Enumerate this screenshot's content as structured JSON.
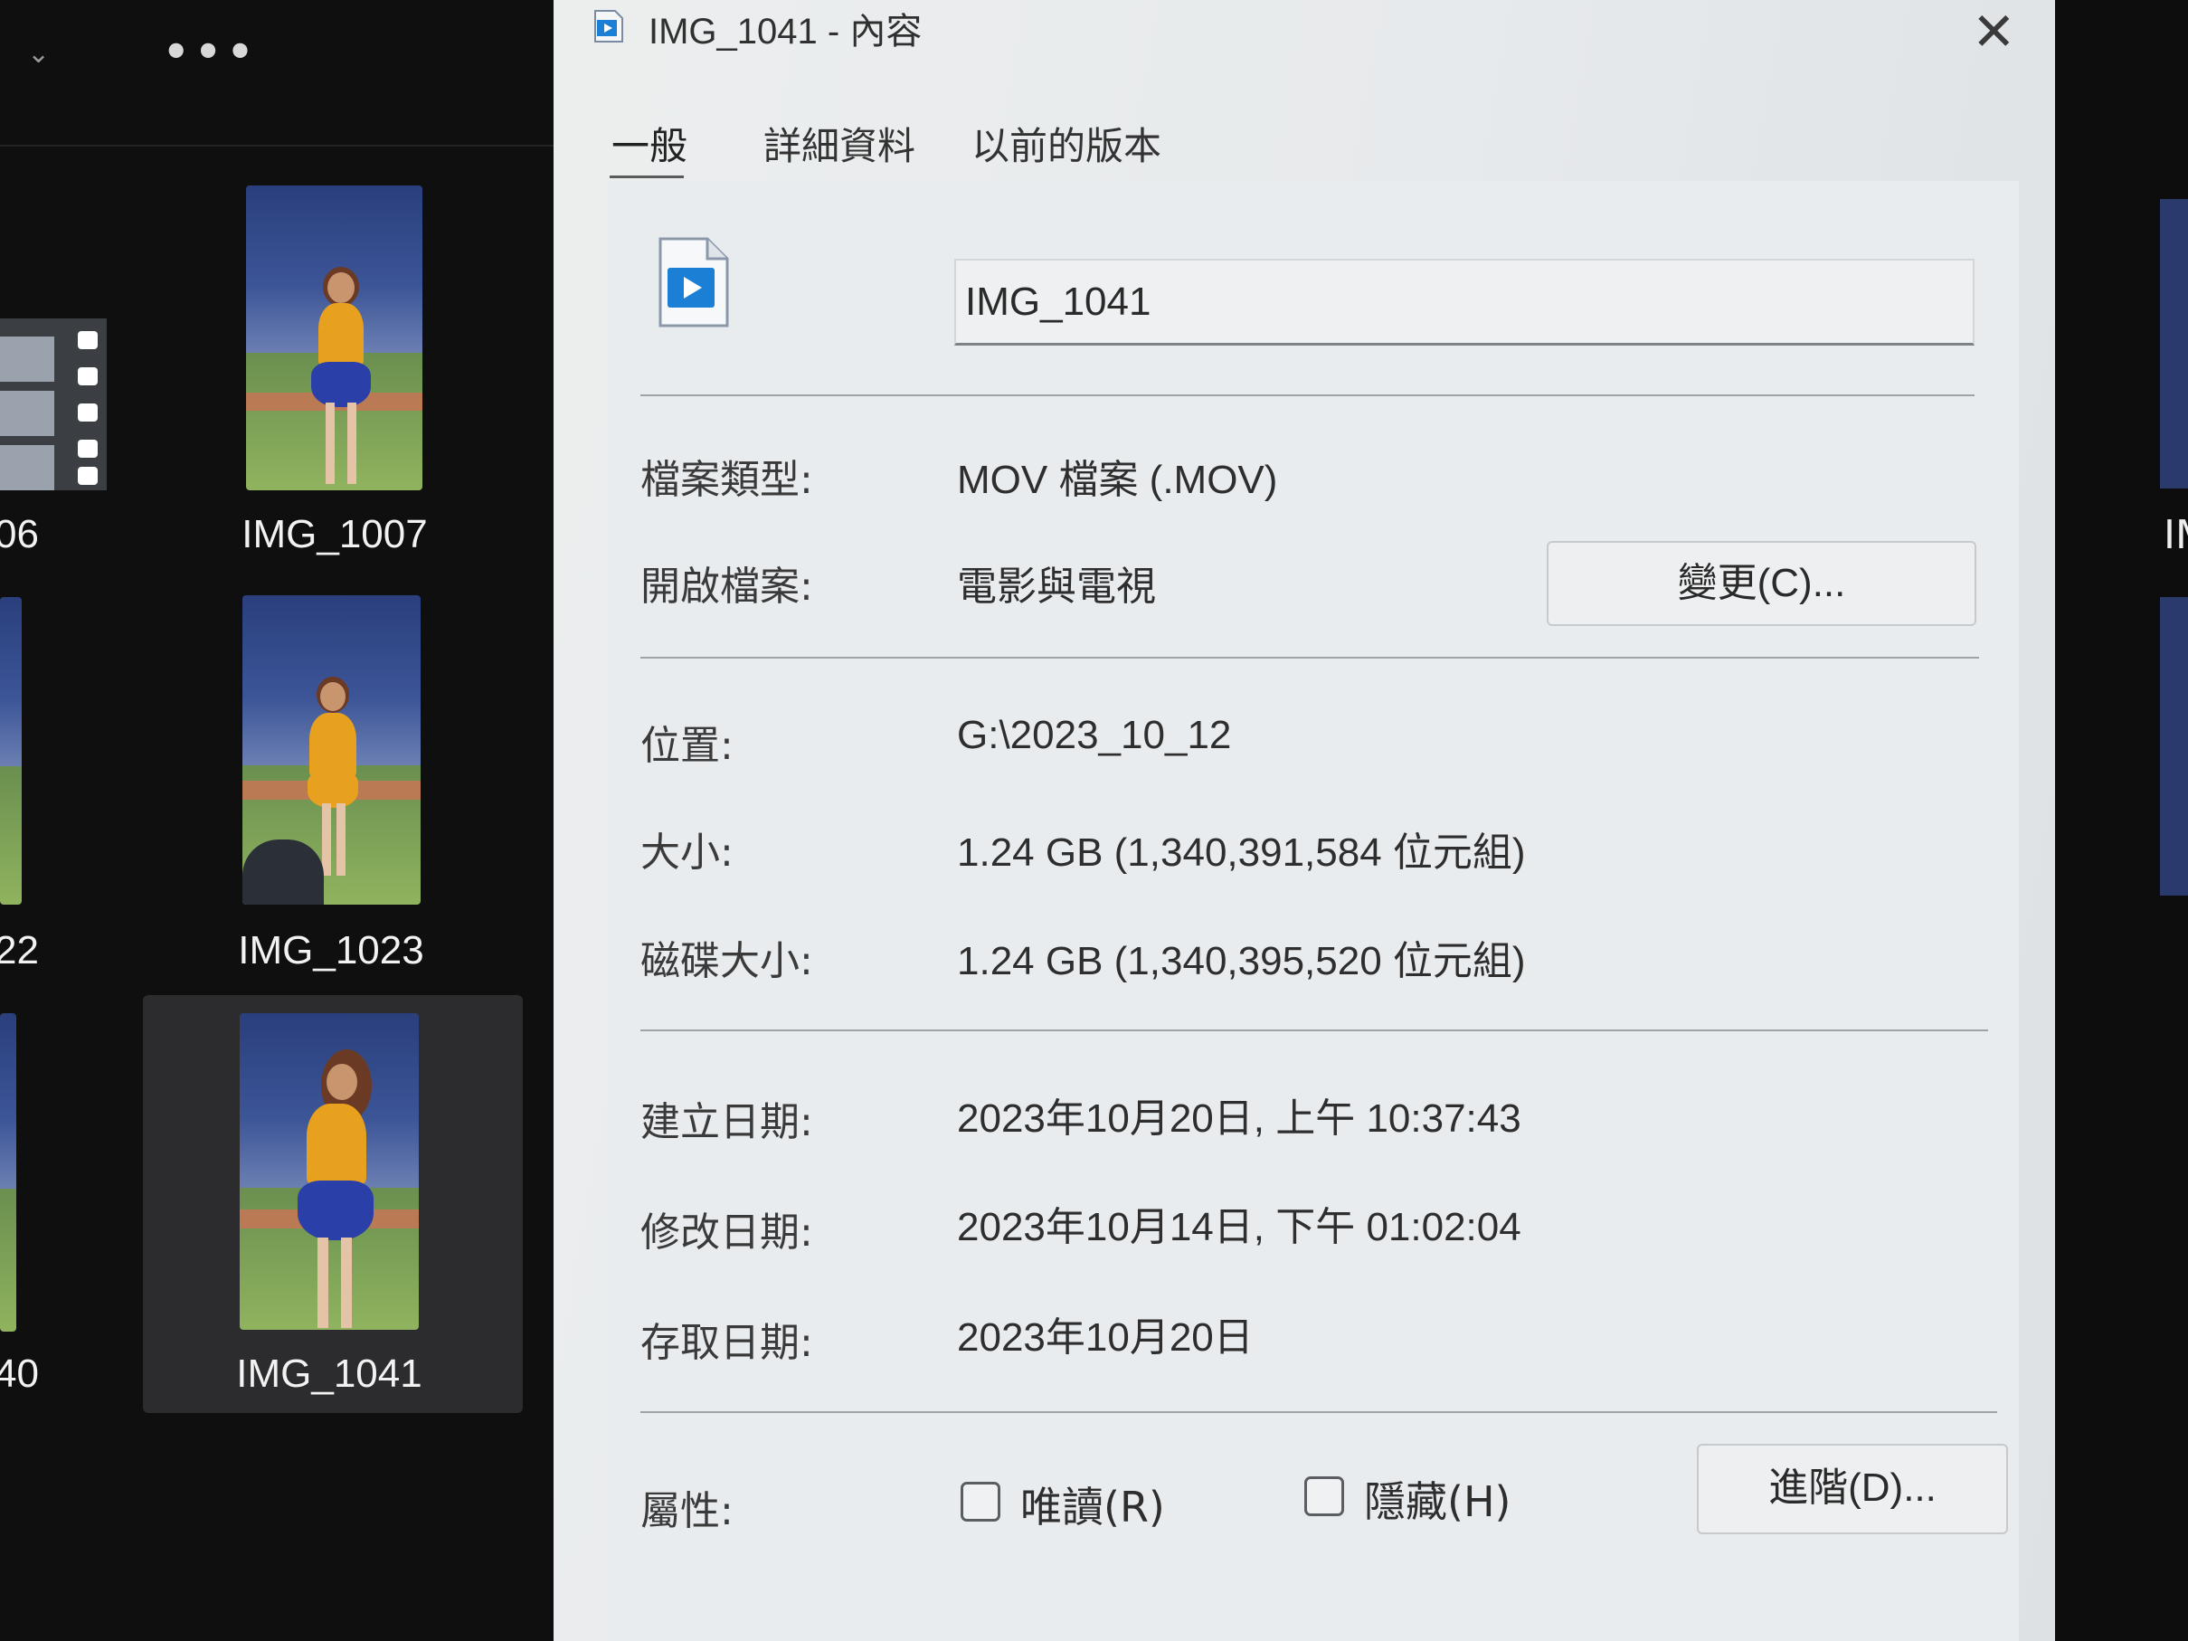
{
  "explorer": {
    "more_label": "•••",
    "thumbnails": [
      {
        "name": "06"
      },
      {
        "name": "IMG_1007"
      },
      {
        "name": "22"
      },
      {
        "name": "IMG_1023"
      },
      {
        "name": "40"
      },
      {
        "name": "IMG_1041"
      }
    ],
    "right_label": "IM"
  },
  "dialog": {
    "title": "IMG_1041 - 內容",
    "tabs": [
      "一般",
      "詳細資料",
      "以前的版本"
    ],
    "active_tab": "一般",
    "filename": "IMG_1041",
    "fields": {
      "file_type_label": "檔案類型:",
      "file_type_value": "MOV 檔案 (.MOV)",
      "opens_with_label": "開啟檔案:",
      "opens_with_value": "電影與電視",
      "change_button": "變更(C)...",
      "location_label": "位置:",
      "location_value": "G:\\2023_10_12",
      "size_label": "大小:",
      "size_value": "1.24 GB (1,340,391,584 位元組)",
      "disk_size_label": "磁碟大小:",
      "disk_size_value": "1.24 GB (1,340,395,520 位元組)",
      "created_label": "建立日期:",
      "created_value": "2023年10月20日, 上午 10:37:43",
      "modified_label": "修改日期:",
      "modified_value": "2023年10月14日, 下午 01:02:04",
      "accessed_label": "存取日期:",
      "accessed_value": "2023年10月20日",
      "attributes_label": "屬性:",
      "readonly_label": "唯讀(R)",
      "readonly_checked": false,
      "hidden_label": "隱藏(H)",
      "hidden_checked": false,
      "advanced_button": "進階(D)..."
    },
    "accent_color": "#1b7fd6"
  }
}
